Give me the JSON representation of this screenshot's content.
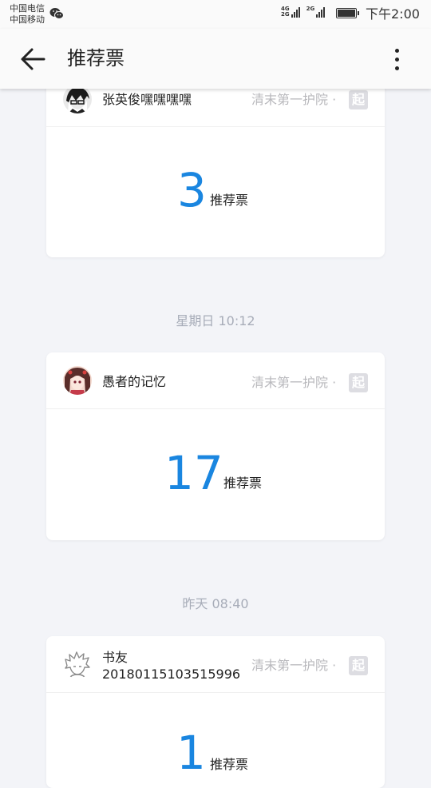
{
  "status_bar": {
    "carrier_1": "中国电信",
    "carrier_2": "中国移动",
    "net_1_top": "4G",
    "net_1_bottom": "2G",
    "net_2": "2G",
    "time": "下午2:00"
  },
  "app_bar": {
    "title": "推荐票"
  },
  "feed": {
    "items": [
      {
        "user": "张英俊嘿嘿嘿嘿",
        "book": "清末第一护院 ·",
        "badge": "起",
        "count": "3",
        "unit": "推荐票"
      },
      {
        "time": "星期日 10:12",
        "user": "愚者的记忆",
        "book": "清末第一护院 ·",
        "badge": "起",
        "count": "17",
        "unit": "推荐票"
      },
      {
        "time": "昨天 08:40",
        "user_line1": "书友",
        "user_line2": "20180115103515996",
        "book": "清末第一护院 ·",
        "badge": "起",
        "count": "1",
        "unit": "推荐票"
      }
    ]
  },
  "colors": {
    "accent": "#1a86e0",
    "background": "#f3f4f8",
    "muted_text": "#b8b8bc"
  }
}
